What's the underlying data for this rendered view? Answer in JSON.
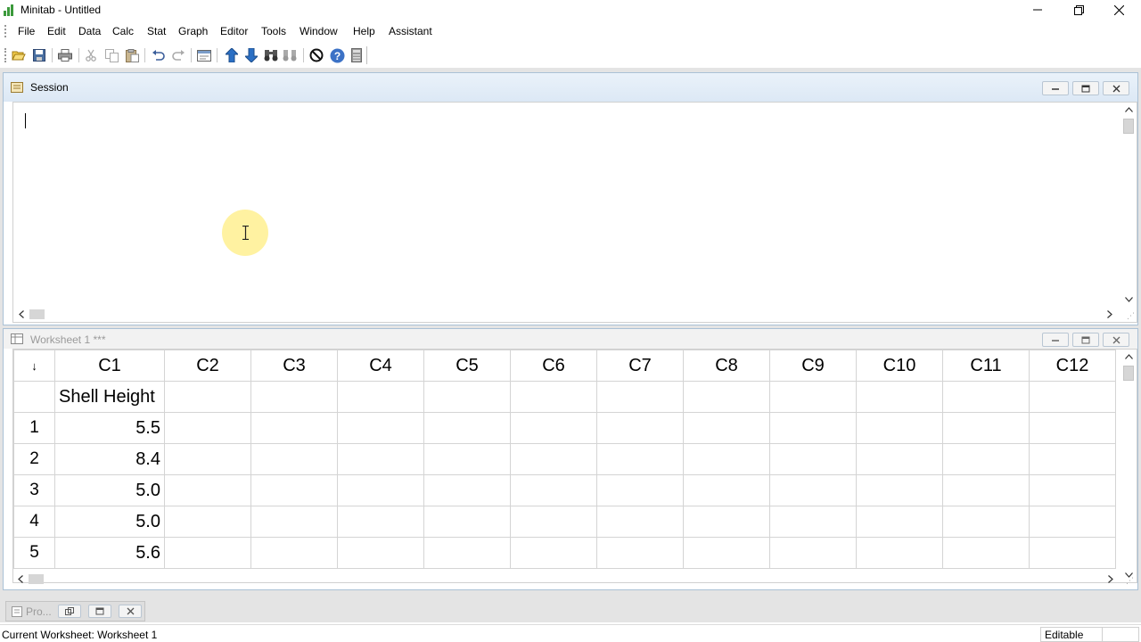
{
  "app": {
    "title": "Minitab - Untitled"
  },
  "menu": [
    "File",
    "Edit",
    "Data",
    "Calc",
    "Stat",
    "Graph",
    "Editor",
    "Tools",
    "Window",
    "Help",
    "Assistant"
  ],
  "session": {
    "title": "Session"
  },
  "worksheet": {
    "title": "Worksheet 1 ***",
    "corner_label": "↓",
    "columns": [
      "C1",
      "C2",
      "C3",
      "C4",
      "C5",
      "C6",
      "C7",
      "C8",
      "C9",
      "C10",
      "C11",
      "C12"
    ],
    "column_names": [
      "Shell Height",
      "",
      "",
      "",
      "",
      "",
      "",
      "",
      "",
      "",
      "",
      ""
    ],
    "rows": [
      {
        "index": "1",
        "cells": [
          "5.5",
          "",
          "",
          "",
          "",
          "",
          "",
          "",
          "",
          "",
          "",
          ""
        ]
      },
      {
        "index": "2",
        "cells": [
          "8.4",
          "",
          "",
          "",
          "",
          "",
          "",
          "",
          "",
          "",
          "",
          ""
        ]
      },
      {
        "index": "3",
        "cells": [
          "5.0",
          "",
          "",
          "",
          "",
          "",
          "",
          "",
          "",
          "",
          "",
          ""
        ]
      },
      {
        "index": "4",
        "cells": [
          "5.0",
          "",
          "",
          "",
          "",
          "",
          "",
          "",
          "",
          "",
          "",
          ""
        ]
      },
      {
        "index": "5",
        "cells": [
          "5.6",
          "",
          "",
          "",
          "",
          "",
          "",
          "",
          "",
          "",
          "",
          ""
        ]
      }
    ]
  },
  "project_tab": {
    "label": "Pro..."
  },
  "status": {
    "text": "Current Worksheet: Worksheet 1",
    "mode": "Editable"
  },
  "icons": {
    "toolbar": [
      "open-icon",
      "save-icon",
      "print-icon",
      "cut-icon",
      "copy-icon",
      "paste-icon",
      "undo-icon",
      "redo-icon",
      "show-session-icon",
      "previous-command-icon",
      "next-command-icon",
      "find-icon",
      "replace-icon",
      "cancel-icon",
      "help-icon",
      "calculator-icon"
    ]
  },
  "colors": {
    "accent": "#2b6fc4",
    "session_title_bg": "#dce8f5",
    "cursor_halo": "#ffee82"
  }
}
